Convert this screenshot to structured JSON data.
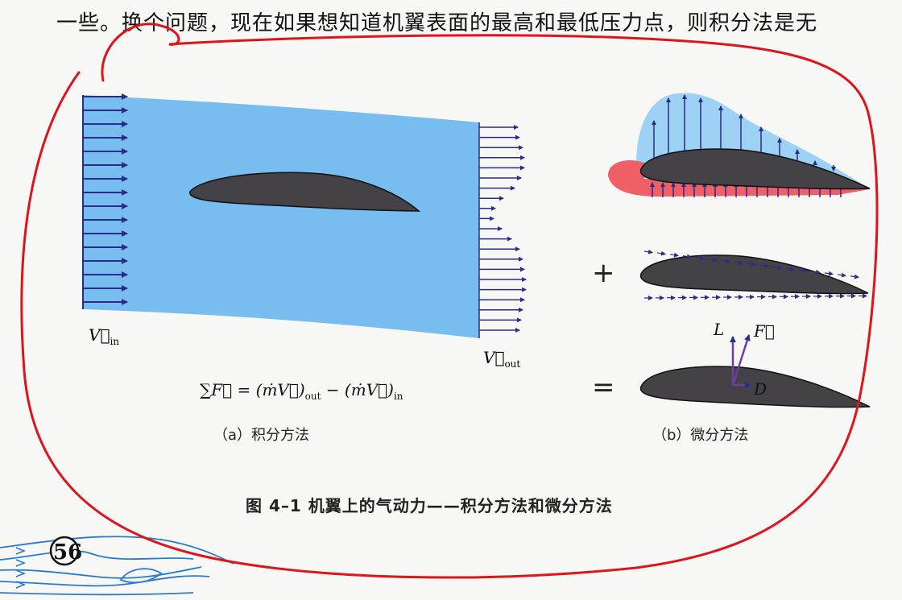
{
  "body_text": "一些。换个问题，现在如果想知道机翼表面的最高和最低压力点，则积分法是无",
  "figure": {
    "caption": "图 4–1  机翼上的气动力——积分方法和微分方法",
    "panel_a": {
      "label": "（a）积分方法",
      "v_in": {
        "symbol": "V⃗",
        "subscript": "in"
      },
      "v_out": {
        "symbol": "V⃗",
        "subscript": "out"
      },
      "equation": {
        "lhs": "∑F⃗ = ",
        "term1": "(ṁV⃗)",
        "term1_sub": "out",
        "minus": " − ",
        "term2": "(ṁV⃗)",
        "term2_sub": "in"
      }
    },
    "panel_b": {
      "label": "（b）微分方法",
      "plus_sign": "+",
      "equals_sign": "=",
      "lift_label": "L",
      "force_label": "F⃗",
      "drag_label": "D"
    }
  },
  "page_number": "56",
  "colors": {
    "flow_blue": "#77bdf0",
    "arrow": "#2b2b8a",
    "airfoil": "#454247",
    "pressure_red": "#ef5f66",
    "annotation_red": "#e0131b",
    "streamline": "#2a7bd0"
  }
}
